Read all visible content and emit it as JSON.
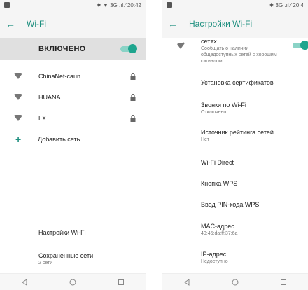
{
  "left": {
    "status": {
      "right": "✱ ▼ 3G .ıl ⁄ 20:42"
    },
    "appbar": {
      "back": "←",
      "title": "Wi-Fi"
    },
    "toggle": {
      "label": "ВКЛЮЧЕНО",
      "on": true
    },
    "networks": [
      {
        "name": "ChinaNet-caun",
        "locked": true
      },
      {
        "name": "HUANA",
        "locked": true
      },
      {
        "name": "LX",
        "locked": true
      }
    ],
    "add_network": {
      "icon": "+",
      "label": "Добавить сеть"
    },
    "bottom": {
      "settings": "Настройки Wi-Fi",
      "saved": "Сохраненные сети",
      "saved_sub": "2 сети"
    }
  },
  "right": {
    "status": {
      "right": "✱ 3G .ıl ⁄ 20:4"
    },
    "appbar": {
      "back": "←",
      "title": "Настройки Wi-Fi"
    },
    "notify": {
      "title": "сетях",
      "sub": "Сообщать о наличии общедоступных сетей с хорошим сигналом",
      "on": true
    },
    "items": [
      {
        "title": "Установка сертификатов",
        "sub": ""
      },
      {
        "title": "Звонки по Wi-Fi",
        "sub": "Отключено"
      },
      {
        "title": "Источник рейтинга сетей",
        "sub": "Нет"
      },
      {
        "title": "Wi-Fi Direct",
        "sub": ""
      },
      {
        "title": "Кнопка WPS",
        "sub": ""
      },
      {
        "title": "Ввод PIN-кода WPS",
        "sub": ""
      },
      {
        "title": "MAC-адрес",
        "sub": "40:45:da:ff:37:6a"
      },
      {
        "title": "IP-адрес",
        "sub": "Недоступно"
      }
    ]
  },
  "colors": {
    "accent": "#1e8f7f",
    "switch_on": "#1ea58e"
  }
}
